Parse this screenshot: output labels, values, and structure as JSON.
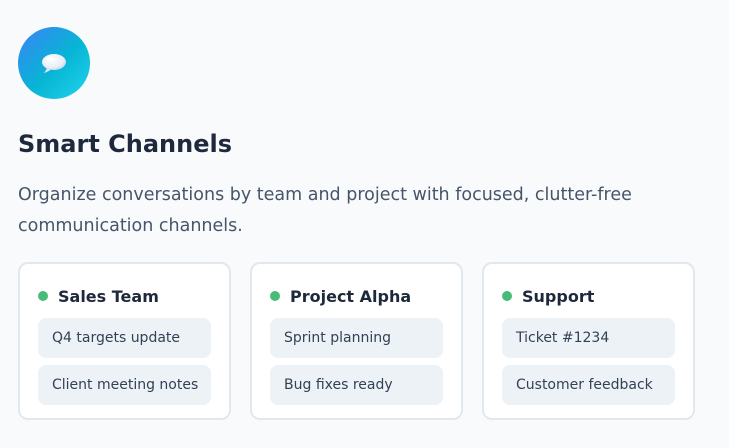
{
  "feature": {
    "icon": "chat-bubble-icon",
    "title": "Smart Channels",
    "description": "Organize conversations by team and project with focused, clutter-free communication channels."
  },
  "channels": [
    {
      "name": "Sales Team",
      "status_color": "#48bb78",
      "messages": [
        "Q4 targets update",
        "Client meeting notes"
      ]
    },
    {
      "name": "Project Alpha",
      "status_color": "#48bb78",
      "messages": [
        "Sprint planning",
        "Bug fixes ready"
      ]
    },
    {
      "name": "Support",
      "status_color": "#48bb78",
      "messages": [
        "Ticket #1234",
        "Customer feedback"
      ]
    }
  ],
  "colors": {
    "accent_gradient_start": "#3b82f6",
    "accent_gradient_end": "#22d3ee",
    "status_online": "#48bb78"
  }
}
